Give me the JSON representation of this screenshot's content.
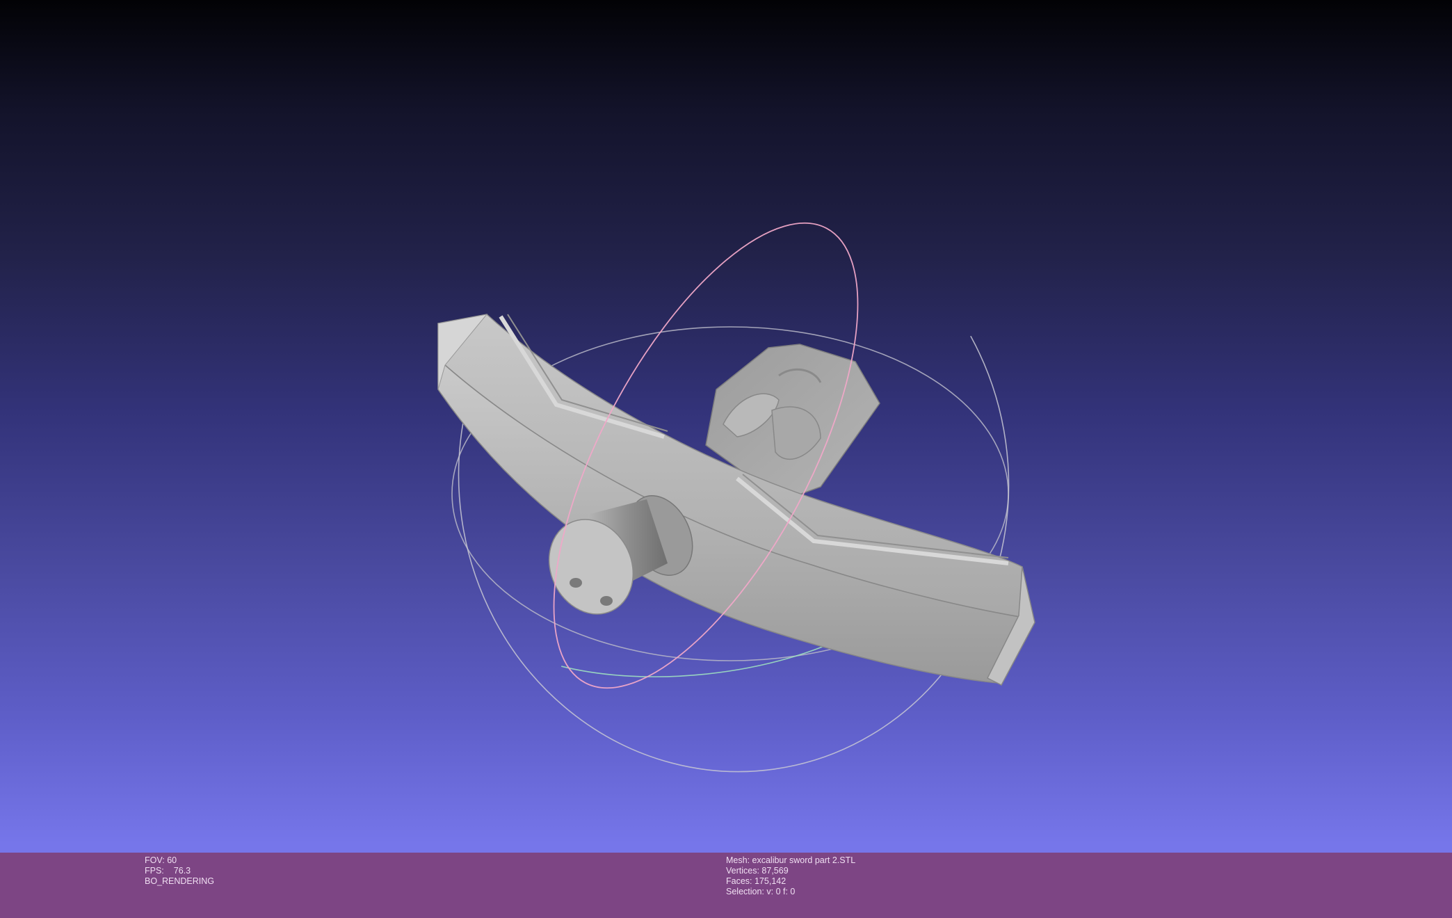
{
  "viewer": {
    "background_top": "#020205",
    "background_bottom": "#7a7af0",
    "mesh_color": "#bdbdbd",
    "trackball_colors": [
      "#c9c9cf",
      "#e8a0b8",
      "#a0e0b8"
    ]
  },
  "info_left": {
    "fov_label": "FOV:",
    "fov_value": "60",
    "fps_label": "FPS:",
    "fps_value": "76.3",
    "mode": "BO_RENDERING"
  },
  "info_right": {
    "mesh": "Mesh: excalibur sword part 2.STL",
    "vertices": "Vertices: 87,569",
    "faces": "Faces: 175,142",
    "selection": "Selection: v: 0 f: 0"
  },
  "info_bar_color": "#7d4584"
}
